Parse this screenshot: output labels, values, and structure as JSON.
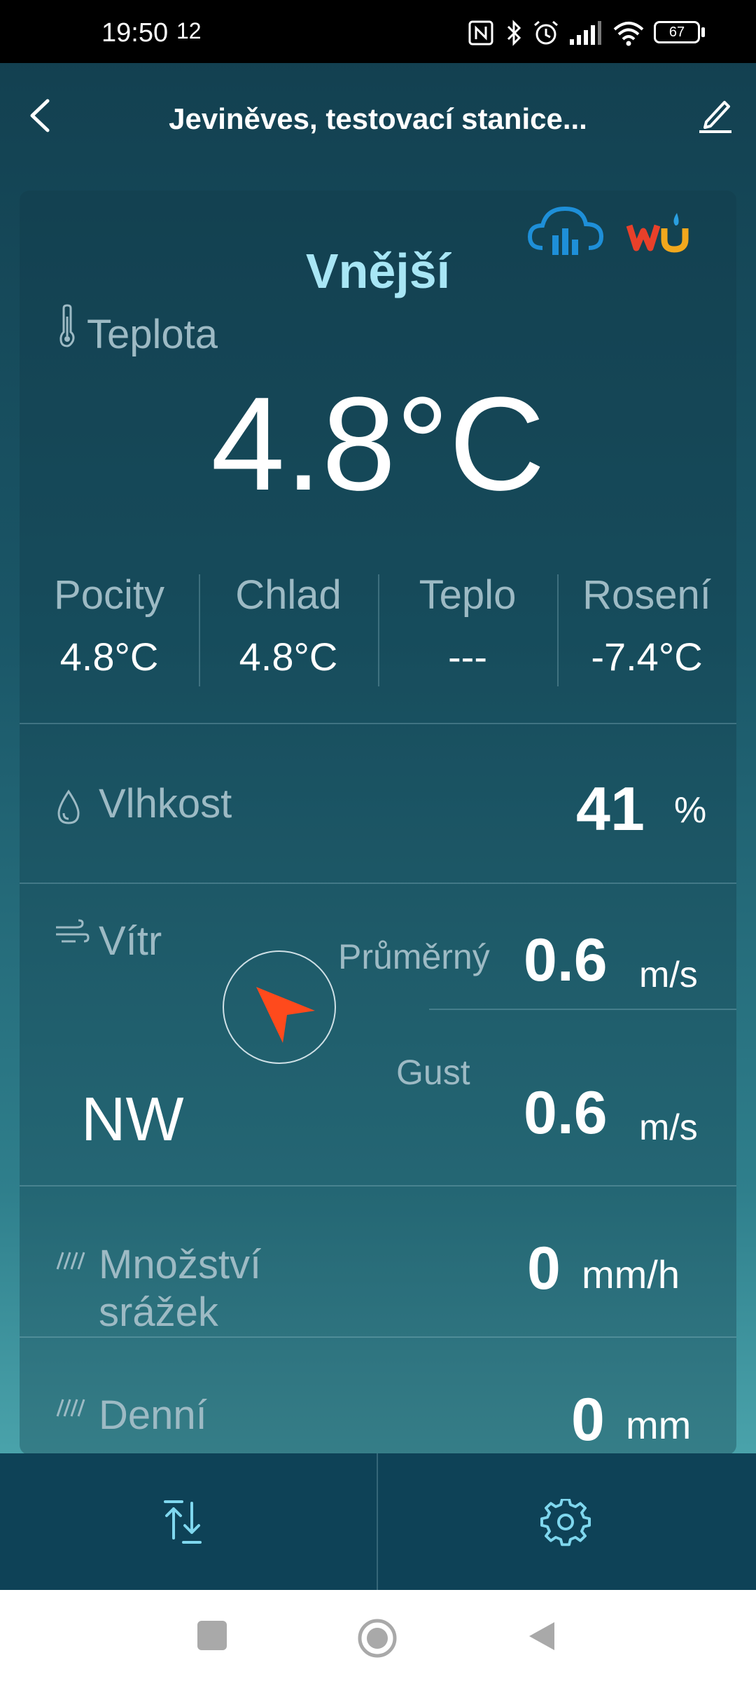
{
  "status_bar": {
    "time": "19:50",
    "seconds": "12",
    "battery": "67",
    "icons": [
      "nfc-icon",
      "bluetooth-icon",
      "alarm-icon",
      "signal-icon",
      "wifi-icon",
      "battery-icon"
    ]
  },
  "header": {
    "title": "Jeviněves, testovací stanice...",
    "back_icon": "chevron-left-icon",
    "edit_icon": "pencil-icon"
  },
  "card": {
    "section_title": "Vnější",
    "logos": [
      "cloud-chart-logo",
      "wu-logo"
    ],
    "temperature": {
      "label": "Teplota",
      "value": "4.8°C"
    },
    "stats": [
      {
        "label": "Pocity",
        "value": "4.8°C"
      },
      {
        "label": "Chlad",
        "value": "4.8°C"
      },
      {
        "label": "Teplo",
        "value": "---"
      },
      {
        "label": "Rosení",
        "value": "-7.4°C"
      }
    ],
    "humidity": {
      "label": "Vlhkost",
      "value": "41",
      "unit": "%"
    },
    "wind": {
      "label": "Vítr",
      "direction": "NW",
      "average_label": "Průměrný",
      "average_value": "0.6",
      "average_unit": "m/s",
      "gust_label": "Gust",
      "gust_value": "0.6",
      "gust_unit": "m/s"
    },
    "rain_rate": {
      "label": "Množství srážek",
      "value": "0",
      "unit": "mm/h"
    },
    "rain_daily": {
      "label": "Denní",
      "value": "0",
      "unit": "mm"
    }
  },
  "colors": {
    "accent": "#a8e6f5",
    "label": "#9dbac4",
    "compass_arrow": "#ff4a1c",
    "bottom_bar": "#0e4257"
  }
}
